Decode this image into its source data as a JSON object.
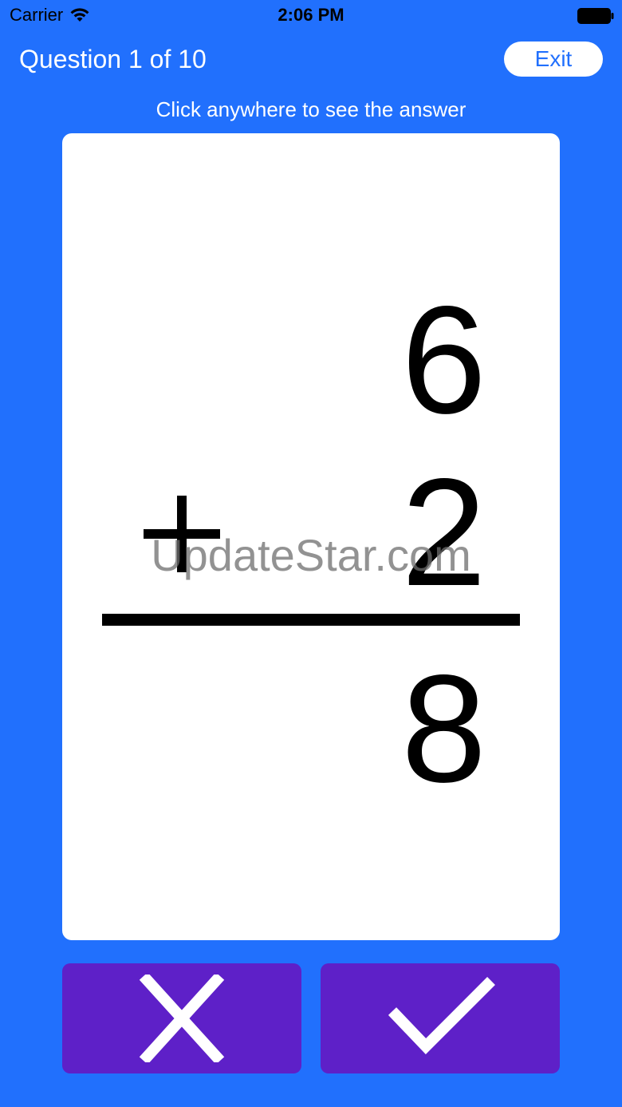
{
  "status_bar": {
    "carrier": "Carrier",
    "time": "2:06 PM"
  },
  "header": {
    "question_label": "Question 1 of 10",
    "exit_label": "Exit"
  },
  "hint": "Click anywhere to see the answer",
  "card": {
    "top_number": "6",
    "operator": "+",
    "bottom_number": "2",
    "answer": "8"
  },
  "watermark": "UpdateStar.com",
  "buttons": {
    "wrong_icon": "x-mark-icon",
    "right_icon": "checkmark-icon"
  },
  "colors": {
    "background": "#2170fd",
    "button": "#5e20c8",
    "card": "#ffffff"
  }
}
